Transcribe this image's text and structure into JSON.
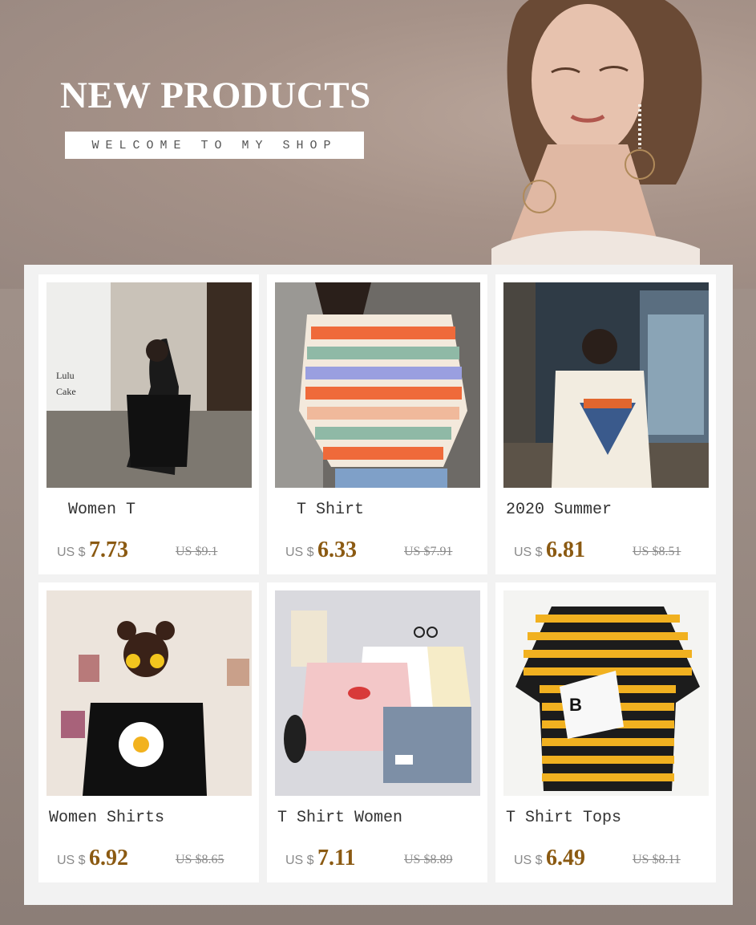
{
  "hero": {
    "title": "NEW PRODUCTS",
    "subtitle": "WELCOME TO MY SHOP"
  },
  "colors": {
    "background": "#a4948c",
    "panel": "#f2f2f2",
    "price": "#8b5a12",
    "muted": "#8a8a8a"
  },
  "products": [
    {
      "name": "  Women T",
      "currency": "US $",
      "price": "7.73",
      "old_price": "US $9.1"
    },
    {
      "name": "  T Shirt",
      "currency": "US $",
      "price": "6.33",
      "old_price": "US $7.91"
    },
    {
      "name": "2020 Summer",
      "currency": "US $",
      "price": "6.81",
      "old_price": "US $8.51"
    },
    {
      "name": "Women Shirts",
      "currency": "US $",
      "price": "6.92",
      "old_price": "US $8.65"
    },
    {
      "name": "T Shirt Women",
      "currency": "US $",
      "price": "7.11",
      "old_price": "US $8.89"
    },
    {
      "name": "T Shirt Tops",
      "currency": "US $",
      "price": "6.49",
      "old_price": "US $8.11"
    }
  ]
}
